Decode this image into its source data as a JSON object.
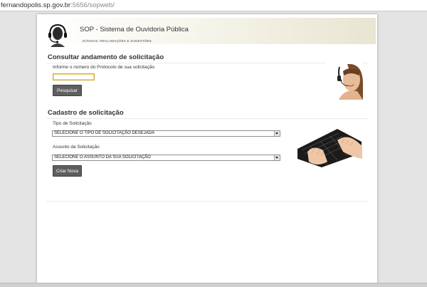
{
  "browser": {
    "url_domain": "fernandopolis.sp.gov.br",
    "url_rest": ":5656/sopweb/"
  },
  "header": {
    "title": "SOP - Sistema de Ouvidoria Pública",
    "subtitle": "DÚVIDAS, RECLAMAÇÕES E SUGESTÕES"
  },
  "consultar": {
    "title": "Consultar andamento de solicitação",
    "instruction": "Informe o número do Protocolo de sua solicitação",
    "protocol_value": "",
    "search_button": "Pesquisar"
  },
  "cadastro": {
    "title": "Cadastro de solicitação",
    "tipo_label": "Tipo de Solicitação",
    "tipo_selected": "SELECIONE O TIPO DE SOLICITAÇÃO DESEJADA",
    "assunto_label": "Assunto da Solicitação",
    "assunto_selected": "SELECIONE O ASSUNTO DA SUA SOLICITAÇÃO",
    "create_button": "Criar Nova"
  }
}
